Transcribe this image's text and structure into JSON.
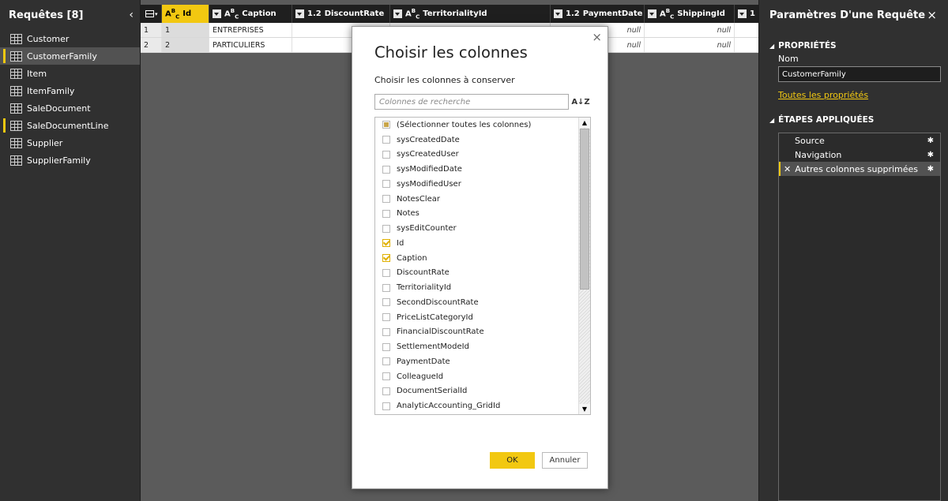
{
  "queries_pane": {
    "title": "Requêtes [8]",
    "collapse_glyph": "‹",
    "items": [
      {
        "label": "Customer"
      },
      {
        "label": "CustomerFamily"
      },
      {
        "label": "Item"
      },
      {
        "label": "ItemFamily"
      },
      {
        "label": "SaleDocument"
      },
      {
        "label": "SaleDocumentLine"
      },
      {
        "label": "Supplier"
      },
      {
        "label": "SupplierFamily"
      }
    ],
    "selected_index": 1
  },
  "grid": {
    "columns": [
      {
        "type": "ABC",
        "name": "Id"
      },
      {
        "type": "ABC",
        "name": "Caption"
      },
      {
        "type": "1.2",
        "name": "DiscountRate"
      },
      {
        "type": "ABC",
        "name": "TerritorialityId"
      },
      {
        "type": "1.2",
        "name": "PaymentDate"
      },
      {
        "type": "ABC",
        "name": "ShippingId"
      },
      {
        "type": "",
        "name": "1"
      }
    ],
    "rows": [
      {
        "num": "1",
        "id": "1",
        "caption": "ENTREPRISES",
        "payment": "null",
        "shipping": "null"
      },
      {
        "num": "2",
        "id": "2",
        "caption": "PARTICULIERS",
        "payment": "null",
        "shipping": "null"
      }
    ]
  },
  "dialog": {
    "title": "Choisir les colonnes",
    "subtitle": "Choisir les colonnes à conserver",
    "search_placeholder": "Colonnes de recherche",
    "sort_icon": "A↓Z",
    "close_glyph": "×",
    "columns": [
      {
        "label": "(Sélectionner toutes les colonnes)",
        "state": "partial"
      },
      {
        "label": "sysCreatedDate",
        "state": "unchecked"
      },
      {
        "label": "sysCreatedUser",
        "state": "unchecked"
      },
      {
        "label": "sysModifiedDate",
        "state": "unchecked"
      },
      {
        "label": "sysModifiedUser",
        "state": "unchecked"
      },
      {
        "label": "NotesClear",
        "state": "unchecked"
      },
      {
        "label": "Notes",
        "state": "unchecked"
      },
      {
        "label": "sysEditCounter",
        "state": "unchecked"
      },
      {
        "label": "Id",
        "state": "checked"
      },
      {
        "label": "Caption",
        "state": "checked"
      },
      {
        "label": "DiscountRate",
        "state": "unchecked"
      },
      {
        "label": "TerritorialityId",
        "state": "unchecked"
      },
      {
        "label": "SecondDiscountRate",
        "state": "unchecked"
      },
      {
        "label": "PriceListCategoryId",
        "state": "unchecked"
      },
      {
        "label": "FinancialDiscountRate",
        "state": "unchecked"
      },
      {
        "label": "SettlementModeId",
        "state": "unchecked"
      },
      {
        "label": "PaymentDate",
        "state": "unchecked"
      },
      {
        "label": "ColleagueId",
        "state": "unchecked"
      },
      {
        "label": "DocumentSerialId",
        "state": "unchecked"
      },
      {
        "label": "AnalyticAccounting_GridId",
        "state": "unchecked"
      }
    ],
    "ok_label": "OK",
    "cancel_label": "Annuler"
  },
  "settings_pane": {
    "title": "Paramètres D'une Requête",
    "close_glyph": "×",
    "properties_title": "PROPRIÉTÉS",
    "name_label": "Nom",
    "name_value": "CustomerFamily",
    "all_properties_link": "Toutes les propriétés",
    "steps_title": "ÉTAPES APPLIQUÉES",
    "steps": [
      {
        "label": "Source"
      },
      {
        "label": "Navigation"
      },
      {
        "label": "Autres colonnes supprimées"
      }
    ],
    "selected_step_index": 2
  },
  "colors": {
    "accent": "#f2c811",
    "pane_bg": "#303030",
    "canvas_bg": "#5b5b5b"
  }
}
